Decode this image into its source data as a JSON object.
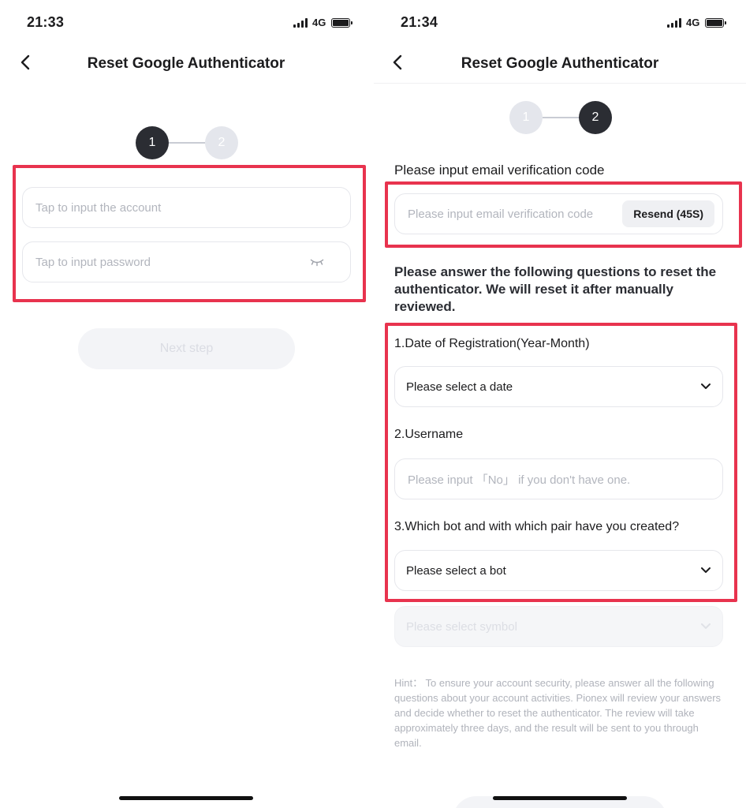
{
  "left_screen": {
    "status_time": "21:33",
    "network": "4G",
    "title": "Reset Google Authenticator",
    "steps": [
      "1",
      "2"
    ],
    "account_placeholder": "Tap to input the account",
    "password_placeholder": "Tap to input password",
    "next_button": "Next step"
  },
  "right_screen": {
    "status_time": "21:34",
    "network": "4G",
    "title": "Reset Google Authenticator",
    "steps": [
      "1",
      "2"
    ],
    "email_code_label": "Please input email verification code",
    "email_code_placeholder": "Please input email verification code",
    "resend_button": "Resend (45S)",
    "instructions": "Please answer the following questions to reset the authenticator. We will reset it after manually reviewed.",
    "q1_label": "1.Date of Registration(Year-Month)",
    "q1_value": "Please select a date",
    "q2_label": "2.Username",
    "q2_placeholder": "Please input 「No」 if you don't have one.",
    "q3_label": "3.Which bot and with which pair have you created?",
    "q3_value": "Please select a bot",
    "symbol_value": "Please select symbol",
    "hint": "Hint： To ensure your account security, please answer all the following questions about your account activities. Pionex will review your answers and decide whether to reset the authenticator. The review will take approximately three days, and the result will be sent to you through email."
  },
  "colors": {
    "highlight": "#e8334e",
    "step_active": "#2b2d33",
    "step_inactive": "#e4e6ec"
  },
  "icons": [
    "back-chevron-icon",
    "eye-closed-icon",
    "chevron-down-icon",
    "signal-icon",
    "battery-icon"
  ]
}
